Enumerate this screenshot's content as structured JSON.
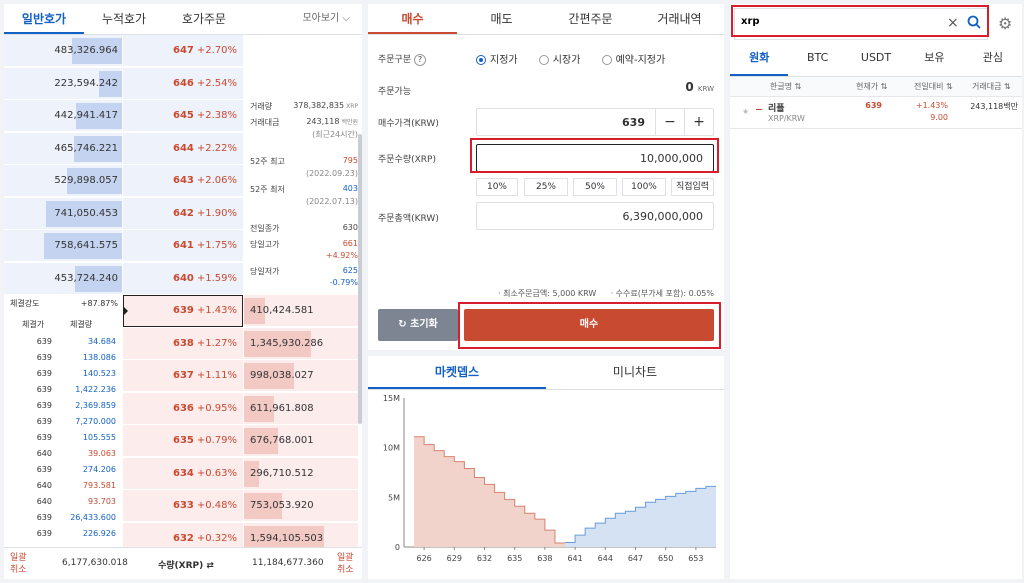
{
  "ob": {
    "tabs": [
      "일반호가",
      "누적호가",
      "호가주문",
      "모아보기 ⌵"
    ],
    "asks": [
      {
        "vol": "483,326.964",
        "price": "647",
        "chg": "+2.70%",
        "w": 0.64
      },
      {
        "vol": "223,594.242",
        "price": "646",
        "chg": "+2.54%",
        "w": 0.3
      },
      {
        "vol": "442,941.417",
        "price": "645",
        "chg": "+2.38%",
        "w": 0.59
      },
      {
        "vol": "465,746.221",
        "price": "644",
        "chg": "+2.22%",
        "w": 0.62
      },
      {
        "vol": "529,898.057",
        "price": "643",
        "chg": "+2.06%",
        "w": 0.7
      },
      {
        "vol": "741,050.453",
        "price": "642",
        "chg": "+1.90%",
        "w": 0.98
      },
      {
        "vol": "758,641.575",
        "price": "641",
        "chg": "+1.75%",
        "w": 1.0
      },
      {
        "vol": "453,724.240",
        "price": "640",
        "chg": "+1.59%",
        "w": 0.6
      }
    ],
    "bids": [
      {
        "vol": "410,424.581",
        "price": "639",
        "chg": "+1.43%",
        "w": 0.26
      },
      {
        "vol": "1,345,930.286",
        "price": "638",
        "chg": "+1.27%",
        "w": 0.84
      },
      {
        "vol": "998,038.027",
        "price": "637",
        "chg": "+1.11%",
        "w": 0.62
      },
      {
        "vol": "611,961.808",
        "price": "636",
        "chg": "+0.95%",
        "w": 0.38
      },
      {
        "vol": "676,768.001",
        "price": "635",
        "chg": "+0.79%",
        "w": 0.42
      },
      {
        "vol": "296,710.512",
        "price": "634",
        "chg": "+0.63%",
        "w": 0.19
      },
      {
        "vol": "753,053.920",
        "price": "633",
        "chg": "+0.48%",
        "w": 0.47
      },
      {
        "vol": "1,594,105.503",
        "price": "632",
        "chg": "+0.32%",
        "w": 1.0
      }
    ],
    "info": [
      {
        "l": "거래량",
        "v": "378,382,835",
        "u": "XRP"
      },
      {
        "l": "거래대금",
        "v": "243,118",
        "u": "백만원"
      },
      {
        "l": "",
        "v": "(최근24시간)",
        "u": ""
      },
      {
        "l": "52주 최고",
        "v": "795",
        "u": ""
      },
      {
        "l": "",
        "v": "(2022.09.23)",
        "u": ""
      },
      {
        "l": "52주 최저",
        "v": "403",
        "u": ""
      },
      {
        "l": "",
        "v": "(2022.07.13)",
        "u": ""
      },
      {
        "l": "전일종가",
        "v": "630",
        "u": ""
      },
      {
        "l": "당일고가",
        "v": "661",
        "u": ""
      },
      {
        "l": "",
        "v": "+4.92%",
        "u": ""
      },
      {
        "l": "당일저가",
        "v": "625",
        "u": ""
      },
      {
        "l": "",
        "v": "-0.79%",
        "u": ""
      }
    ],
    "strength_label": "체결강도",
    "strength": "+87.87%",
    "trade_h1": "체결가",
    "trade_h2": "체결량",
    "trades": [
      [
        "639",
        "34.684"
      ],
      [
        "639",
        "138.086"
      ],
      [
        "639",
        "140.523"
      ],
      [
        "639",
        "1,422.236"
      ],
      [
        "639",
        "2,369.859"
      ],
      [
        "639",
        "7,270.000"
      ],
      [
        "639",
        "105.555"
      ],
      [
        "640",
        "39.063"
      ],
      [
        "639",
        "274.206"
      ],
      [
        "640",
        "793.581"
      ],
      [
        "640",
        "93.703"
      ],
      [
        "639",
        "26,433.600"
      ],
      [
        "639",
        "226.926"
      ]
    ],
    "foot_left": "일괄\n취소",
    "foot_total_ask": "6,177,630.018",
    "foot_label": "수량(XRP) ⇄",
    "foot_total_bid": "11,184,677.360",
    "foot_right": "일괄\n취소"
  },
  "order": {
    "tabs": [
      "매수",
      "매도",
      "간편주문",
      "거래내역"
    ],
    "type_label": "주문구분",
    "types": [
      "지정가",
      "시장가",
      "예약-지정가"
    ],
    "avail_label": "주문가능",
    "avail": "0",
    "avail_unit": "KRW",
    "price_label": "매수가격(KRW)",
    "price": "639",
    "qty_label": "주문수량(XRP)",
    "qty": "10,000,000",
    "pcts": [
      "10%",
      "25%",
      "50%",
      "100%",
      "직접입력"
    ],
    "total_label": "주문총액(KRW)",
    "total": "6,390,000,000",
    "min": "· 최소주문금액: 5,000 KRW",
    "fee": "· 수수료(부가세 포함): 0.05%",
    "reset": "초기화",
    "buy": "매수"
  },
  "depth": {
    "tabs": [
      "마켓뎁스",
      "미니차트"
    ]
  },
  "chart_data": {
    "type": "area",
    "x_ticks": [
      "626",
      "629",
      "632",
      "635",
      "638",
      "641",
      "644",
      "647",
      "650",
      "653"
    ],
    "y_ticks": [
      "15M",
      "10M",
      "5M",
      "0"
    ],
    "ylim": [
      0,
      15000000
    ],
    "bids": {
      "x": [
        625,
        626,
        627,
        628,
        629,
        630,
        631,
        632,
        633,
        634,
        635,
        636,
        637,
        638,
        639
      ],
      "y": [
        11100000,
        10300000,
        9700000,
        9100000,
        8600000,
        7900000,
        7000000,
        6300000,
        5500000,
        4800000,
        4100000,
        3400000,
        2800000,
        1700000,
        400000
      ]
    },
    "asks": {
      "x": [
        640,
        641,
        642,
        643,
        644,
        645,
        646,
        647,
        648,
        649,
        650,
        651,
        652,
        653,
        654
      ],
      "y": [
        450000,
        1200000,
        1900000,
        2400000,
        2900000,
        3400000,
        3600000,
        4000000,
        4500000,
        4800000,
        5100000,
        5400000,
        5600000,
        5900000,
        6100000
      ]
    }
  },
  "coins": {
    "search": "xrp",
    "tabs": [
      "원화",
      "BTC",
      "USDT",
      "보유",
      "관심"
    ],
    "headers": [
      "한글명 ⇅",
      "현재가 ⇅",
      "전일대비 ⇅",
      "거래대금 ⇅"
    ],
    "row": {
      "name": "리플",
      "sym": "XRP/KRW",
      "price": "639",
      "chg": "+1.43%",
      "chg2": "9.00",
      "vol": "243,118백만"
    }
  }
}
